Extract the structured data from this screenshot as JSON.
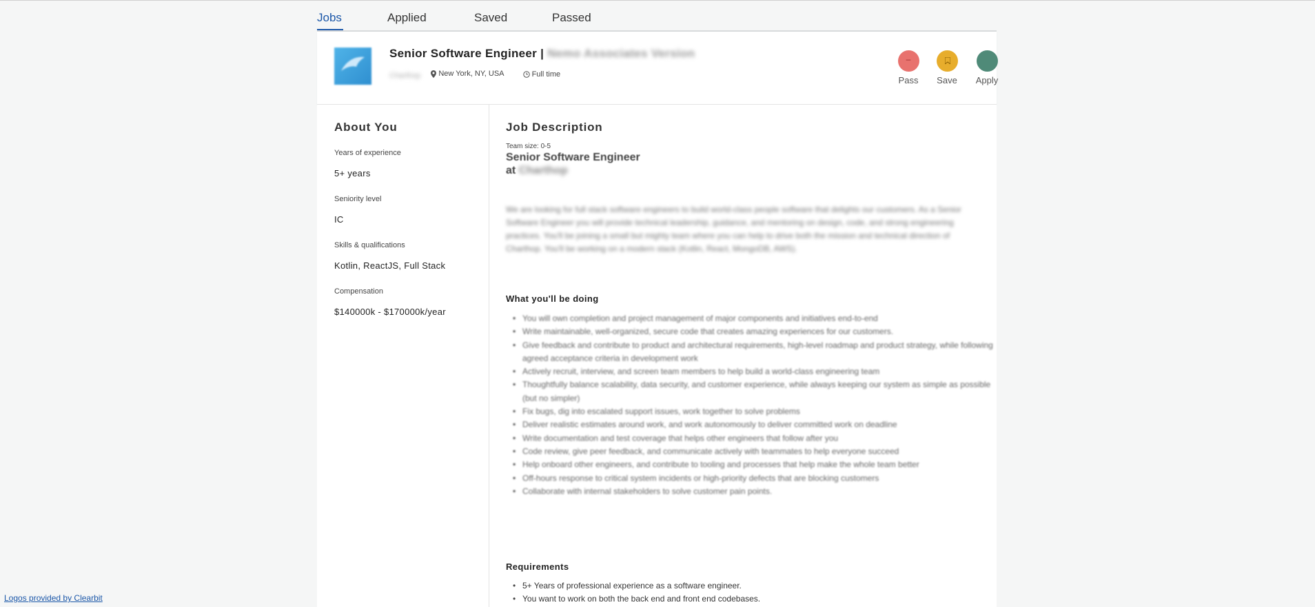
{
  "tabs": [
    "Jobs",
    "Applied",
    "Saved",
    "Passed"
  ],
  "job": {
    "title": "Senior Software Engineer |",
    "company_blurred": "Nemo Associates Version",
    "company_name_blurred": "Charthop",
    "location": "New York, NY, USA",
    "employment_type": "Full time",
    "icons": {
      "location": "map-pin-icon",
      "type": "clock-icon"
    }
  },
  "actions": [
    {
      "label": "Pass",
      "color": "#e8726e"
    },
    {
      "label": "Save",
      "color": "#e7ad2c"
    },
    {
      "label": "Apply",
      "color": "#4f8a78"
    }
  ],
  "about": {
    "title": "About You",
    "fields": [
      {
        "label": "Years of experience",
        "value": "5+ years"
      },
      {
        "label": "Seniority level",
        "value": "IC"
      },
      {
        "label": "Skills & qualifications",
        "value": "Kotlin, ReactJS, Full Stack"
      },
      {
        "label": "Compensation",
        "value": "$140000k - $170000k/year"
      }
    ]
  },
  "description": {
    "title": "Job Description",
    "team_size": "Team size: 0-5",
    "role_line1": "Senior Software Engineer",
    "role_line2_prefix": "at",
    "role_company_blurred": "Charthop",
    "intro": "We are looking for full stack software engineers to build world-class people software that delights our customers. As a Senior Software Engineer you will provide technical leadership, guidance, and mentoring on design, code, and strong engineering practices. You'll be joining a small but mighty team where you can help to drive both the mission and technical direction of Charthop. You'll be working on a modern stack (Kotlin, React, MongoDB, AWS).",
    "doing_title": "What you'll be doing",
    "doing": [
      "You will own completion and project management of major components and initiatives end-to-end",
      "Write maintainable, well-organized, secure code that creates amazing experiences for our customers.",
      "Give feedback and contribute to product and architectural requirements, high-level roadmap and product strategy, while following agreed acceptance criteria in development work",
      "Actively recruit, interview, and screen team members to help build a world-class engineering team",
      "Thoughtfully balance scalability, data security, and customer experience, while always keeping our system as simple as possible (but no simpler)",
      "Fix bugs, dig into escalated support issues, work together to solve problems",
      "Deliver realistic estimates around work, and work autonomously to deliver committed work on deadline",
      "Write documentation and test coverage that helps other engineers that follow after you",
      "Code review, give peer feedback, and communicate actively with teammates to help everyone succeed",
      "Help onboard other engineers, and contribute to tooling and processes that help make the whole team better",
      "Off-hours response to critical system incidents or high-priority defects that are blocking customers",
      "Collaborate with internal stakeholders to solve customer pain points."
    ],
    "req_title": "Requirements",
    "requirements": [
      "5+ Years of professional experience as a software engineer.",
      "You want to work on both the back end and front end codebases."
    ]
  },
  "footer": {
    "clearbit": "Logos provided by Clearbit"
  }
}
